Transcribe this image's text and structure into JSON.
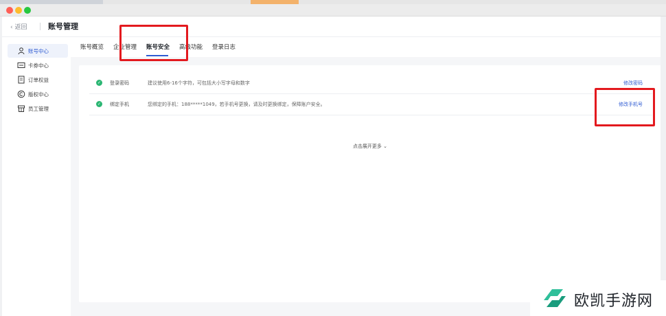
{
  "header": {
    "back_label": "返回",
    "title": "账号管理"
  },
  "sidebar": {
    "items": [
      {
        "label": "账号中心",
        "icon": "user-icon",
        "active": true
      },
      {
        "label": "卡券中心",
        "icon": "card-icon",
        "active": false
      },
      {
        "label": "订单权益",
        "icon": "order-icon",
        "active": false
      },
      {
        "label": "版权中心",
        "icon": "copyright-icon",
        "active": false
      },
      {
        "label": "员工管理",
        "icon": "staff-icon",
        "active": false
      }
    ]
  },
  "tabs": [
    {
      "label": "账号概览",
      "active": false
    },
    {
      "label": "企业管理",
      "active": false
    },
    {
      "label": "账号安全",
      "active": true
    },
    {
      "label": "高级功能",
      "active": false
    },
    {
      "label": "登录日志",
      "active": false
    }
  ],
  "security": {
    "rows": [
      {
        "name": "登录密码",
        "desc": "建议使用6-16个字符，可包括大小写字母和数字",
        "action": "修改密码"
      },
      {
        "name": "绑定手机",
        "desc": "您绑定的手机：188*****1049，若手机号更换，请及时更换绑定，保障账户安全。",
        "action": "修改手机号"
      }
    ],
    "more_label": "点击展开更多"
  },
  "watermark": {
    "text": "欧凯手游网"
  },
  "colors": {
    "accent": "#2f5bd2",
    "success": "#2bb673",
    "highlight": "#e3191e"
  }
}
